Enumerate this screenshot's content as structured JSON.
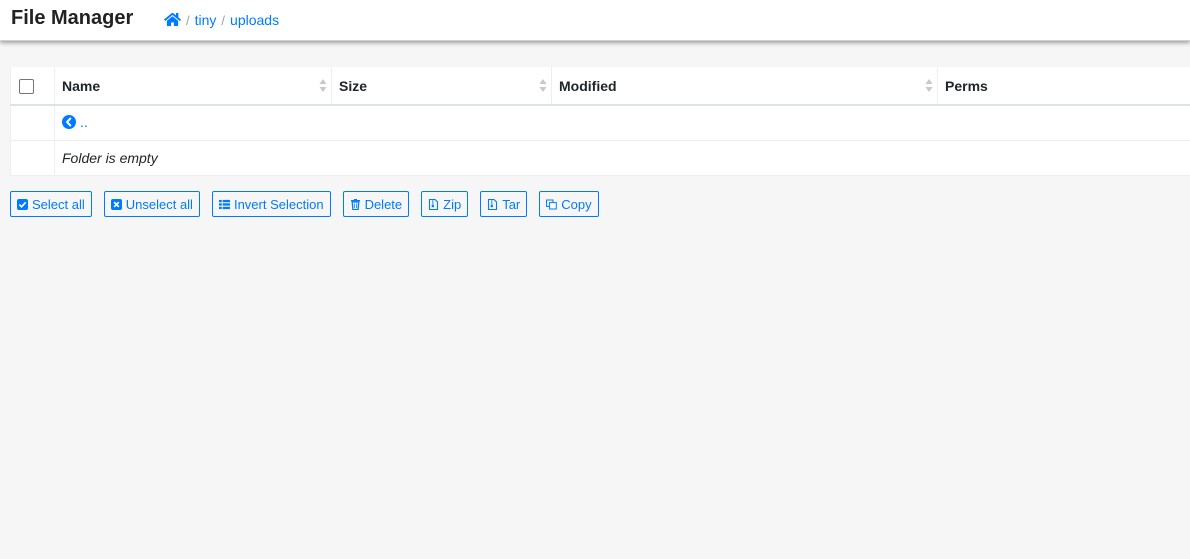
{
  "header": {
    "title": "File Manager",
    "breadcrumb": [
      {
        "label": "tiny"
      },
      {
        "label": "uploads"
      }
    ],
    "separator": "/"
  },
  "table": {
    "columns": [
      "Name",
      "Size",
      "Modified",
      "Perms"
    ],
    "parent_label": "..",
    "empty_message": "Folder is empty"
  },
  "actions": {
    "select_all": "Select all",
    "unselect_all": "Unselect all",
    "invert_selection": "Invert Selection",
    "delete": "Delete",
    "zip": "Zip",
    "tar": "Tar",
    "copy": "Copy"
  },
  "colors": {
    "accent": "#007bff",
    "background": "#f6f6f6"
  },
  "icons": {
    "home": "home-icon",
    "parent": "circle-chevron-left-icon",
    "select_all": "check-square-icon",
    "unselect_all": "x-square-icon",
    "invert_selection": "list-icon",
    "delete": "trash-icon",
    "zip": "file-archive-icon",
    "tar": "file-archive-icon",
    "copy": "copy-icon"
  }
}
